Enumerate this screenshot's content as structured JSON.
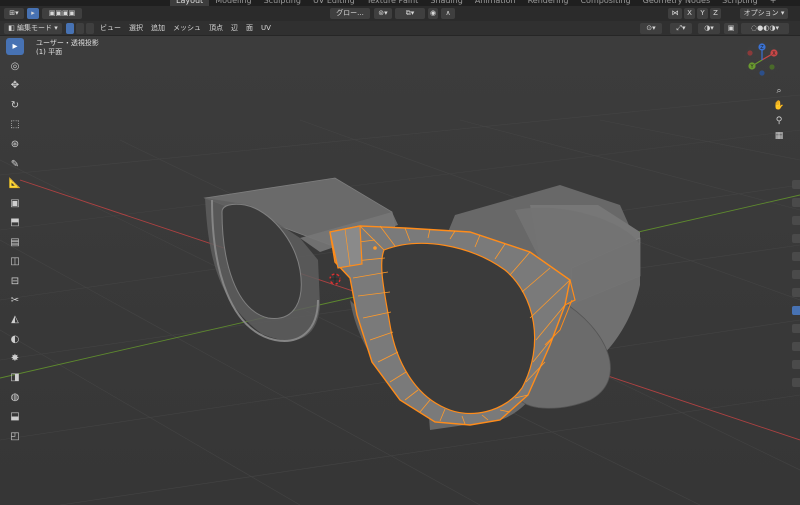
{
  "workspace_tabs": [
    "Layout",
    "Modeling",
    "Sculpting",
    "UV Editing",
    "Texture Paint",
    "Shading",
    "Animation",
    "Rendering",
    "Compositing",
    "Geometry Nodes",
    "Scripting",
    "+"
  ],
  "active_tab": "Layout",
  "header1": {
    "transform_orientation": "グロー...",
    "axis_x": "X",
    "axis_y": "Y",
    "axis_z": "Z",
    "options": "オプション"
  },
  "header2": {
    "mode": "編集モード",
    "menus": [
      "ビュー",
      "選択",
      "追加",
      "メッシュ",
      "頂点",
      "辺",
      "面",
      "UV"
    ]
  },
  "overlay": {
    "view_name": "ユーザー・透視投影",
    "object_name": "(1) 平面"
  },
  "tools": [
    "select-box",
    "cursor",
    "move",
    "rotate",
    "scale",
    "transform",
    "annotate",
    "measure",
    "add-cube",
    "extrude",
    "inset",
    "bevel",
    "loop-cut",
    "knife",
    "poly-build",
    "spin",
    "smooth",
    "edge-slide",
    "shrink-fatten",
    "shear",
    "rip"
  ],
  "gizmo": {
    "x": "X",
    "y": "Y",
    "z": "Z"
  },
  "colors": {
    "accent": "#4772b3",
    "selection": "#ff8c1a",
    "x_axis": "#c84747",
    "y_axis": "#6a9a2f",
    "background": "#3a3a3a"
  }
}
